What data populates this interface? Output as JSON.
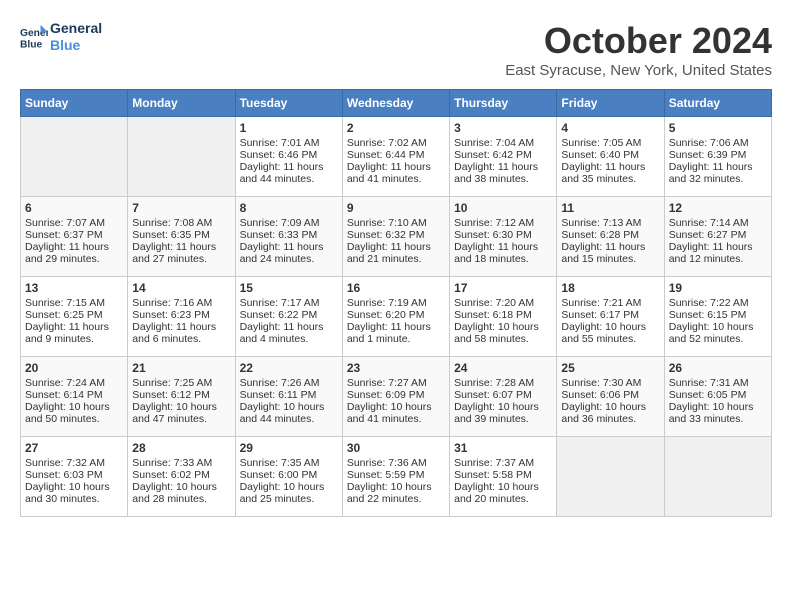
{
  "header": {
    "logo_line1": "General",
    "logo_line2": "Blue",
    "month_title": "October 2024",
    "location": "East Syracuse, New York, United States"
  },
  "days_of_week": [
    "Sunday",
    "Monday",
    "Tuesday",
    "Wednesday",
    "Thursday",
    "Friday",
    "Saturday"
  ],
  "weeks": [
    [
      {
        "day": "",
        "content": ""
      },
      {
        "day": "",
        "content": ""
      },
      {
        "day": "1",
        "content": "Sunrise: 7:01 AM\nSunset: 6:46 PM\nDaylight: 11 hours and 44 minutes."
      },
      {
        "day": "2",
        "content": "Sunrise: 7:02 AM\nSunset: 6:44 PM\nDaylight: 11 hours and 41 minutes."
      },
      {
        "day": "3",
        "content": "Sunrise: 7:04 AM\nSunset: 6:42 PM\nDaylight: 11 hours and 38 minutes."
      },
      {
        "day": "4",
        "content": "Sunrise: 7:05 AM\nSunset: 6:40 PM\nDaylight: 11 hours and 35 minutes."
      },
      {
        "day": "5",
        "content": "Sunrise: 7:06 AM\nSunset: 6:39 PM\nDaylight: 11 hours and 32 minutes."
      }
    ],
    [
      {
        "day": "6",
        "content": "Sunrise: 7:07 AM\nSunset: 6:37 PM\nDaylight: 11 hours and 29 minutes."
      },
      {
        "day": "7",
        "content": "Sunrise: 7:08 AM\nSunset: 6:35 PM\nDaylight: 11 hours and 27 minutes."
      },
      {
        "day": "8",
        "content": "Sunrise: 7:09 AM\nSunset: 6:33 PM\nDaylight: 11 hours and 24 minutes."
      },
      {
        "day": "9",
        "content": "Sunrise: 7:10 AM\nSunset: 6:32 PM\nDaylight: 11 hours and 21 minutes."
      },
      {
        "day": "10",
        "content": "Sunrise: 7:12 AM\nSunset: 6:30 PM\nDaylight: 11 hours and 18 minutes."
      },
      {
        "day": "11",
        "content": "Sunrise: 7:13 AM\nSunset: 6:28 PM\nDaylight: 11 hours and 15 minutes."
      },
      {
        "day": "12",
        "content": "Sunrise: 7:14 AM\nSunset: 6:27 PM\nDaylight: 11 hours and 12 minutes."
      }
    ],
    [
      {
        "day": "13",
        "content": "Sunrise: 7:15 AM\nSunset: 6:25 PM\nDaylight: 11 hours and 9 minutes."
      },
      {
        "day": "14",
        "content": "Sunrise: 7:16 AM\nSunset: 6:23 PM\nDaylight: 11 hours and 6 minutes."
      },
      {
        "day": "15",
        "content": "Sunrise: 7:17 AM\nSunset: 6:22 PM\nDaylight: 11 hours and 4 minutes."
      },
      {
        "day": "16",
        "content": "Sunrise: 7:19 AM\nSunset: 6:20 PM\nDaylight: 11 hours and 1 minute."
      },
      {
        "day": "17",
        "content": "Sunrise: 7:20 AM\nSunset: 6:18 PM\nDaylight: 10 hours and 58 minutes."
      },
      {
        "day": "18",
        "content": "Sunrise: 7:21 AM\nSunset: 6:17 PM\nDaylight: 10 hours and 55 minutes."
      },
      {
        "day": "19",
        "content": "Sunrise: 7:22 AM\nSunset: 6:15 PM\nDaylight: 10 hours and 52 minutes."
      }
    ],
    [
      {
        "day": "20",
        "content": "Sunrise: 7:24 AM\nSunset: 6:14 PM\nDaylight: 10 hours and 50 minutes."
      },
      {
        "day": "21",
        "content": "Sunrise: 7:25 AM\nSunset: 6:12 PM\nDaylight: 10 hours and 47 minutes."
      },
      {
        "day": "22",
        "content": "Sunrise: 7:26 AM\nSunset: 6:11 PM\nDaylight: 10 hours and 44 minutes."
      },
      {
        "day": "23",
        "content": "Sunrise: 7:27 AM\nSunset: 6:09 PM\nDaylight: 10 hours and 41 minutes."
      },
      {
        "day": "24",
        "content": "Sunrise: 7:28 AM\nSunset: 6:07 PM\nDaylight: 10 hours and 39 minutes."
      },
      {
        "day": "25",
        "content": "Sunrise: 7:30 AM\nSunset: 6:06 PM\nDaylight: 10 hours and 36 minutes."
      },
      {
        "day": "26",
        "content": "Sunrise: 7:31 AM\nSunset: 6:05 PM\nDaylight: 10 hours and 33 minutes."
      }
    ],
    [
      {
        "day": "27",
        "content": "Sunrise: 7:32 AM\nSunset: 6:03 PM\nDaylight: 10 hours and 30 minutes."
      },
      {
        "day": "28",
        "content": "Sunrise: 7:33 AM\nSunset: 6:02 PM\nDaylight: 10 hours and 28 minutes."
      },
      {
        "day": "29",
        "content": "Sunrise: 7:35 AM\nSunset: 6:00 PM\nDaylight: 10 hours and 25 minutes."
      },
      {
        "day": "30",
        "content": "Sunrise: 7:36 AM\nSunset: 5:59 PM\nDaylight: 10 hours and 22 minutes."
      },
      {
        "day": "31",
        "content": "Sunrise: 7:37 AM\nSunset: 5:58 PM\nDaylight: 10 hours and 20 minutes."
      },
      {
        "day": "",
        "content": ""
      },
      {
        "day": "",
        "content": ""
      }
    ]
  ]
}
